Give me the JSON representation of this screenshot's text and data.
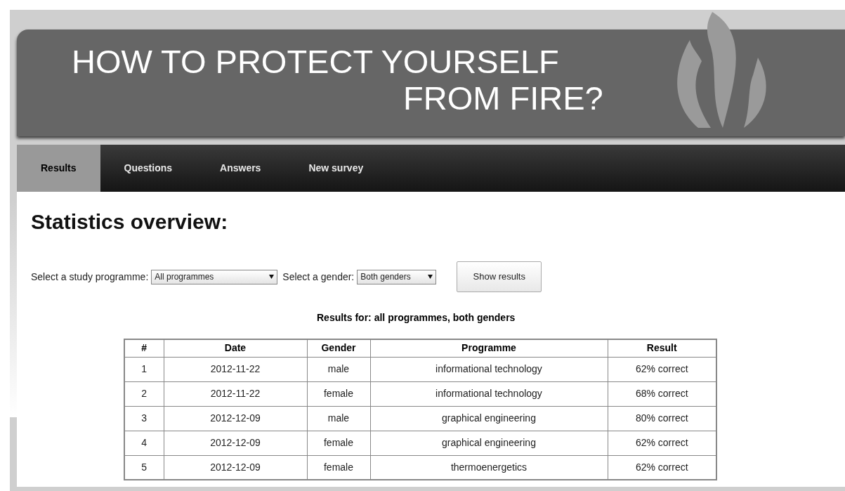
{
  "header": {
    "title_line_1": "HOW TO PROTECT YOURSELF",
    "title_line_2": "FROM FIRE?"
  },
  "tabs": [
    {
      "label": "Results",
      "selected": true
    },
    {
      "label": "Questions",
      "selected": false
    },
    {
      "label": "Answers",
      "selected": false
    },
    {
      "label": "New survey",
      "selected": false
    }
  ],
  "heading": "Statistics overview:",
  "filters": {
    "programme_label": "Select a study programme:",
    "programme_value": "All programmes",
    "gender_label": "Select a gender:",
    "gender_value": "Both genders",
    "button": "Show results"
  },
  "results_caption": "Results for: all programmes, both genders",
  "table": {
    "columns": [
      "#",
      "Date",
      "Gender",
      "Programme",
      "Result"
    ],
    "rows": [
      [
        "1",
        "2012-11-22",
        "male",
        "informational technology",
        "62% correct"
      ],
      [
        "2",
        "2012-11-22",
        "female",
        "informational technology",
        "68% correct"
      ],
      [
        "3",
        "2012-12-09",
        "male",
        "graphical engineering",
        "80% correct"
      ],
      [
        "4",
        "2012-12-09",
        "female",
        "graphical engineering",
        "62% correct"
      ],
      [
        "5",
        "2012-12-09",
        "female",
        "thermoenergetics",
        "62% correct"
      ]
    ]
  }
}
